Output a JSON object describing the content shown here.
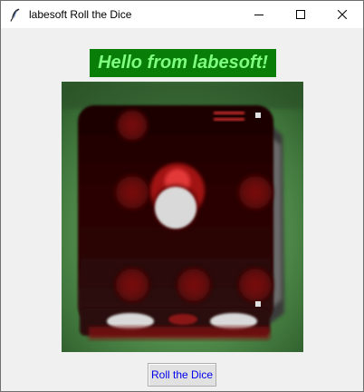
{
  "window": {
    "title": "labesoft Roll the Dice",
    "icon": "feather-icon",
    "controls": [
      "minimize-icon",
      "maximize-icon",
      "close-icon"
    ]
  },
  "banner": {
    "text": "Hello from labesoft!",
    "background": "#087d08",
    "color": "#7fff7f"
  },
  "dice_image": {
    "subject": "red casino die showing one face",
    "face_value": 1
  },
  "roll_button": {
    "label": "Roll the Dice",
    "color": "#0000ee"
  },
  "colors": {
    "window_bg": "#f0f0f0",
    "titlebar_bg": "#ffffff",
    "image_background": "#3f7a3c",
    "die_body": "#2a0606",
    "pip_white": "#d8d8d8"
  }
}
